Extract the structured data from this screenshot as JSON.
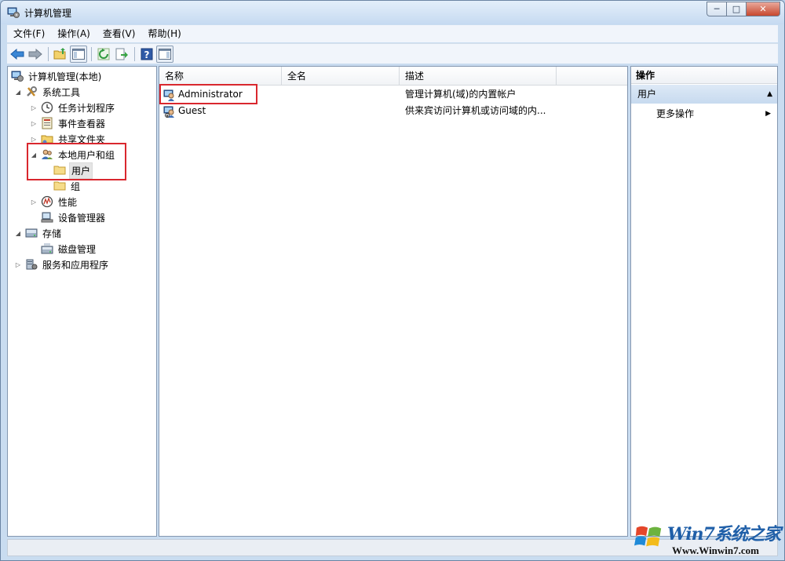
{
  "window": {
    "title": "计算机管理",
    "controls": {
      "minimize": "─",
      "maximize": "□",
      "close": "✕"
    }
  },
  "menubar": {
    "items": [
      "文件(F)",
      "操作(A)",
      "查看(V)",
      "帮助(H)"
    ]
  },
  "toolbar": {
    "icons": [
      "back-arrow-icon",
      "forward-arrow-icon",
      "up-folder-icon",
      "show-hide-tree-icon",
      "refresh-icon",
      "export-list-icon",
      "help-icon",
      "show-hide-action-pane-icon"
    ]
  },
  "tree": {
    "root": "计算机管理(本地)",
    "system_tools": "系统工具",
    "task_scheduler": "任务计划程序",
    "event_viewer": "事件查看器",
    "shared_folders": "共享文件夹",
    "local_users_groups": "本地用户和组",
    "users": "用户",
    "groups": "组",
    "performance": "性能",
    "device_manager": "设备管理器",
    "storage": "存储",
    "disk_management": "磁盘管理",
    "services_apps": "服务和应用程序"
  },
  "list": {
    "columns": [
      "名称",
      "全名",
      "描述"
    ],
    "rows": [
      {
        "name": "Administrator",
        "fullname": "",
        "description": "管理计算机(域)的内置帐户"
      },
      {
        "name": "Guest",
        "fullname": "",
        "description": "供来宾访问计算机或访问域的内..."
      }
    ]
  },
  "actions": {
    "header": "操作",
    "section": "用户",
    "more": "更多操作"
  },
  "watermark": {
    "title": "Win7系统之家",
    "url": "Www.Winwin7.com"
  },
  "colors": {
    "highlight": "#d9272e",
    "accent": "#c7daef",
    "watermark_blue": "#1f5fa8"
  }
}
